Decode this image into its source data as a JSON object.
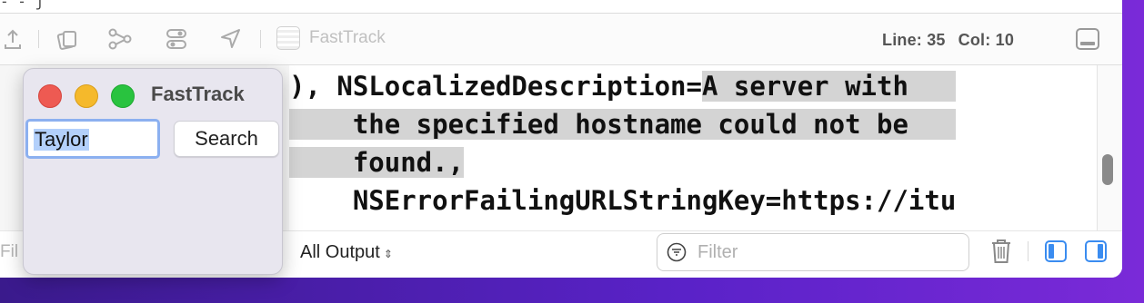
{
  "editor": {
    "top_fragment": "- - j",
    "scheme_app": "FastTrack",
    "line_label": "Line: 35",
    "col_label": "Col: 10"
  },
  "console": {
    "lines": [
      "), NSLocalizedDescription=A server with",
      "    the specified hostname could not be",
      "    found.,",
      "    NSErrorFailingURLStringKey=https://itu"
    ]
  },
  "bottombar": {
    "left_filter_fragment": "Fil",
    "output_selector": "All Output",
    "filter_placeholder": "Filter"
  },
  "app_window": {
    "title": "FastTrack",
    "name_field_value": "Taylor",
    "search_button": "Search"
  },
  "icons": [
    "share-icon",
    "library-icon",
    "source-control-icon",
    "toggle-icon",
    "location-icon",
    "panel-toggle-icon",
    "filter-icon",
    "trash-icon",
    "split-left-icon",
    "split-right-icon"
  ],
  "colors": {
    "selection_highlight": "#d4d4d4",
    "field_focus_ring": "#8cb0f0",
    "text_selection": "#b3d0fb",
    "traffic_red": "#ee5a52",
    "traffic_yellow": "#f5b92b",
    "traffic_green": "#29c33f",
    "accent_blue": "#3a8cf0"
  }
}
